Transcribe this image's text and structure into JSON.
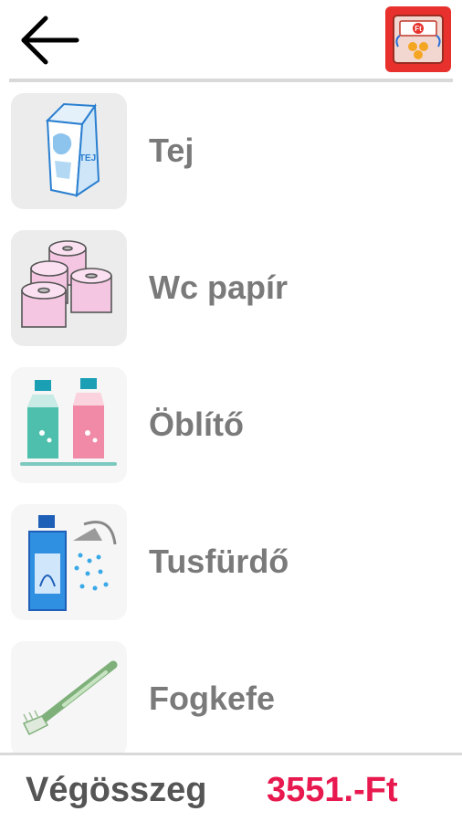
{
  "header": {
    "back_icon": "arrow-left-icon",
    "app_icon": "ft-coin-wallet-icon"
  },
  "items": [
    {
      "label": "Tej",
      "icon": "milk-carton-icon"
    },
    {
      "label": "Wc papír",
      "icon": "toilet-paper-icon"
    },
    {
      "label": "Öblítő",
      "icon": "fabric-softener-icon"
    },
    {
      "label": "Tusfürdő",
      "icon": "shower-gel-icon"
    },
    {
      "label": "Fogkefe",
      "icon": "toothbrush-icon"
    }
  ],
  "milk_carton_text": "TEJ",
  "app_icon_text": "Ft",
  "footer": {
    "total_label": "Végösszeg",
    "total_value": "3551.-Ft"
  },
  "colors": {
    "accent": "#e8194f",
    "app_icon_bg": "#e8312c",
    "label": "#7a7a7a"
  }
}
